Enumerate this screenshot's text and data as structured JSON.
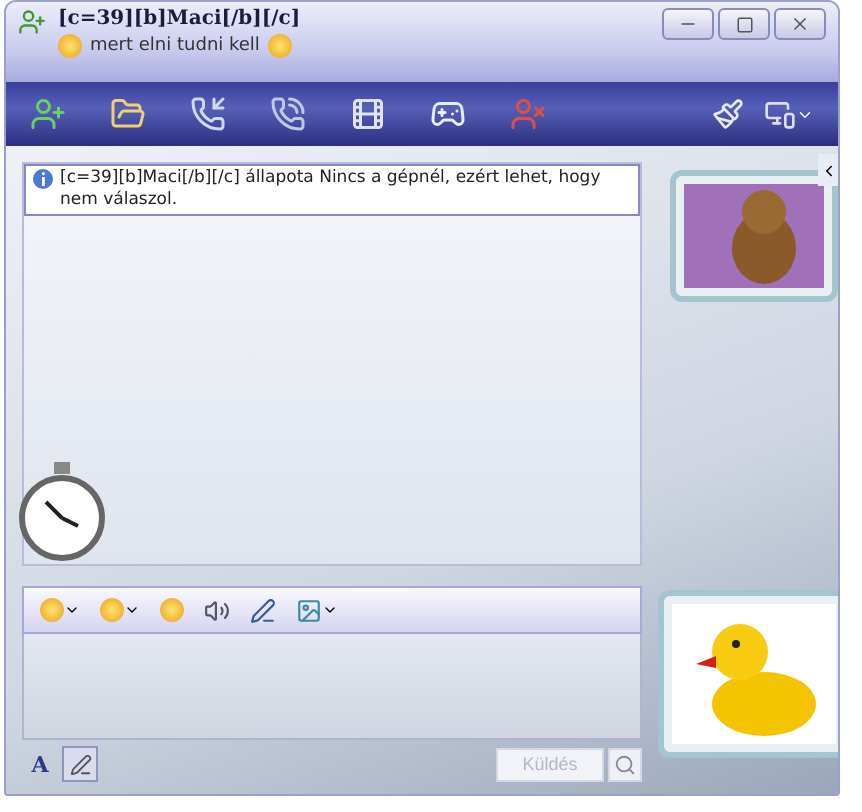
{
  "window": {
    "title": "[c=39][b]Maci[/b][/c]",
    "status_message": "mert elni tudni kell"
  },
  "info_message": "[c=39][b]Maci[/b][/c] állapota Nincs a gépnél, ezért lehet, hogy nem válaszol.",
  "format_buttons": [
    {
      "kind": "font",
      "label": "A",
      "selected": false
    },
    {
      "kind": "pen",
      "selected": true
    }
  ],
  "send_button": {
    "label": "Küldés",
    "disabled": true
  }
}
